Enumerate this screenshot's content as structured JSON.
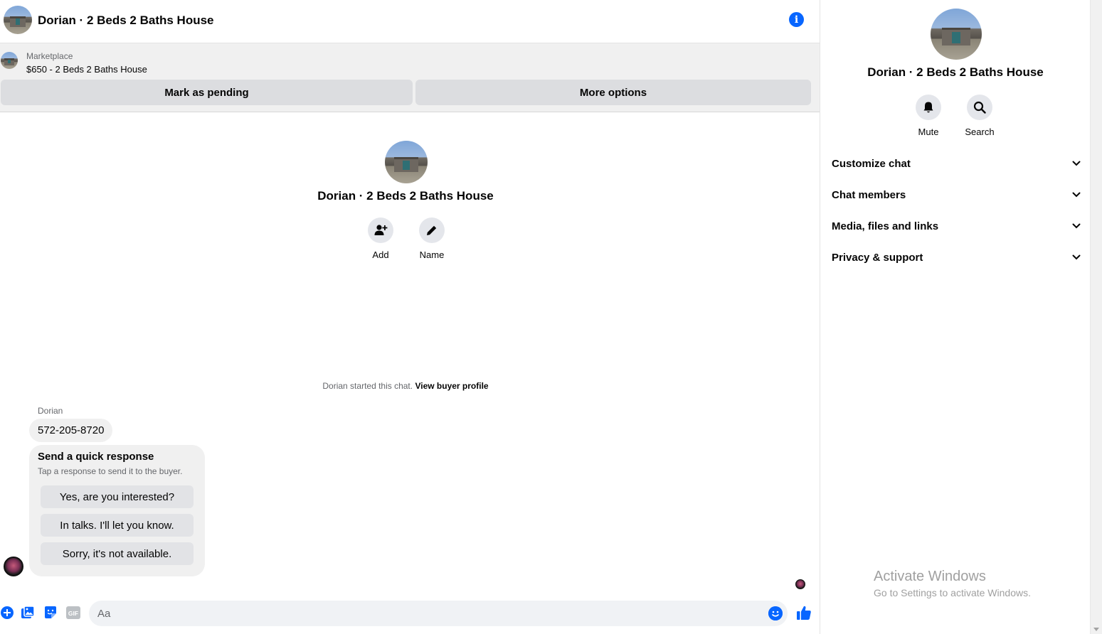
{
  "header": {
    "title": "Dorian · 2 Beds 2 Baths House"
  },
  "marketplace": {
    "label": "Marketplace",
    "listing": "$650 - 2 Beds 2 Baths House",
    "mark_pending_label": "Mark as pending",
    "more_options_label": "More options"
  },
  "intro": {
    "title": "Dorian · 2 Beds 2 Baths House",
    "add_label": "Add",
    "name_label": "Name"
  },
  "conversation": {
    "started_text": "Dorian started this chat.",
    "view_profile_link": "View buyer profile",
    "sender_name": "Dorian",
    "phone_message": "572-205-8720"
  },
  "quick_response": {
    "title": "Send a quick response",
    "subtitle": "Tap a response to send it to the buyer.",
    "options": [
      "Yes, are you interested?",
      "In talks. I'll let you know.",
      "Sorry, it's not available."
    ]
  },
  "composer": {
    "placeholder": "Aa",
    "gif_label": "GIF"
  },
  "right_panel": {
    "title": "Dorian · 2 Beds 2 Baths House",
    "mute_label": "Mute",
    "search_label": "Search",
    "sections": [
      "Customize chat",
      "Chat members",
      "Media, files and links",
      "Privacy & support"
    ]
  },
  "watermark": {
    "title": "Activate Windows",
    "subtitle": "Go to Settings to activate Windows."
  },
  "colors": {
    "accent": "#0866ff",
    "button_bg": "#dcdde0",
    "bubble_bg": "#f0f0f0",
    "muted_text": "#65676b"
  }
}
